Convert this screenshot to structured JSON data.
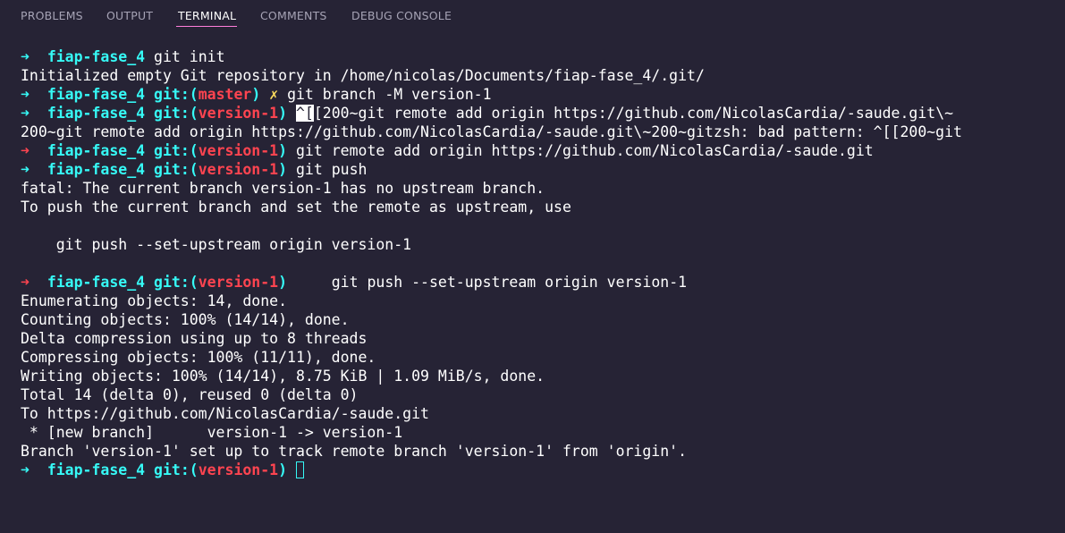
{
  "panel": {
    "tabs": [
      "PROBLEMS",
      "OUTPUT",
      "TERMINAL",
      "COMMENTS",
      "DEBUG CONSOLE"
    ],
    "active_tab": "TERMINAL"
  },
  "prompt": {
    "arrow": "➜",
    "dir": "fiap-fase_4",
    "git_open": "git:(",
    "git_close": ")",
    "dirty_mark": "✗"
  },
  "terminal": {
    "l1_cmd": "git init",
    "l2_out": "Initialized empty Git repository in /home/nicolas/Documents/fiap-fase_4/.git/",
    "l3_branch": "master",
    "l3_cmd": "git branch -M version-1",
    "l4_branch": "version-1",
    "l4_esc": "^[",
    "l4_cmd": "[200~git remote add origin https://github.com/NicolasCardia/-saude.git\\~",
    "l5_out": "200~git remote add origin https://github.com/NicolasCardia/-saude.git\\~200~gitzsh: bad pattern: ^[[200~git",
    "l6_branch": "version-1",
    "l6_cmd": "git remote add origin https://github.com/NicolasCardia/-saude.git",
    "l7_branch": "version-1",
    "l7_cmd": "git push",
    "l8_out": "fatal: The current branch version-1 has no upstream branch.",
    "l9_out": "To push the current branch and set the remote as upstream, use",
    "l11_out": "    git push --set-upstream origin version-1",
    "l13_branch": "version-1",
    "l13_cmd": "    git push --set-upstream origin version-1",
    "l14_out": "Enumerating objects: 14, done.",
    "l15_out": "Counting objects: 100% (14/14), done.",
    "l16_out": "Delta compression using up to 8 threads",
    "l17_out": "Compressing objects: 100% (11/11), done.",
    "l18_out": "Writing objects: 100% (14/14), 8.75 KiB | 1.09 MiB/s, done.",
    "l19_out": "Total 14 (delta 0), reused 0 (delta 0)",
    "l20_out": "To https://github.com/NicolasCardia/-saude.git",
    "l21_out": " * [new branch]      version-1 -> version-1",
    "l22_out": "Branch 'version-1' set up to track remote branch 'version-1' from 'origin'.",
    "l23_branch": "version-1"
  },
  "colors": {
    "background": "#262335",
    "prompt_cyan": "#36f9f6",
    "branch_red": "#fe4450",
    "dirty_yellow": "#fede5d",
    "tab_underline": "#ff7edb"
  }
}
